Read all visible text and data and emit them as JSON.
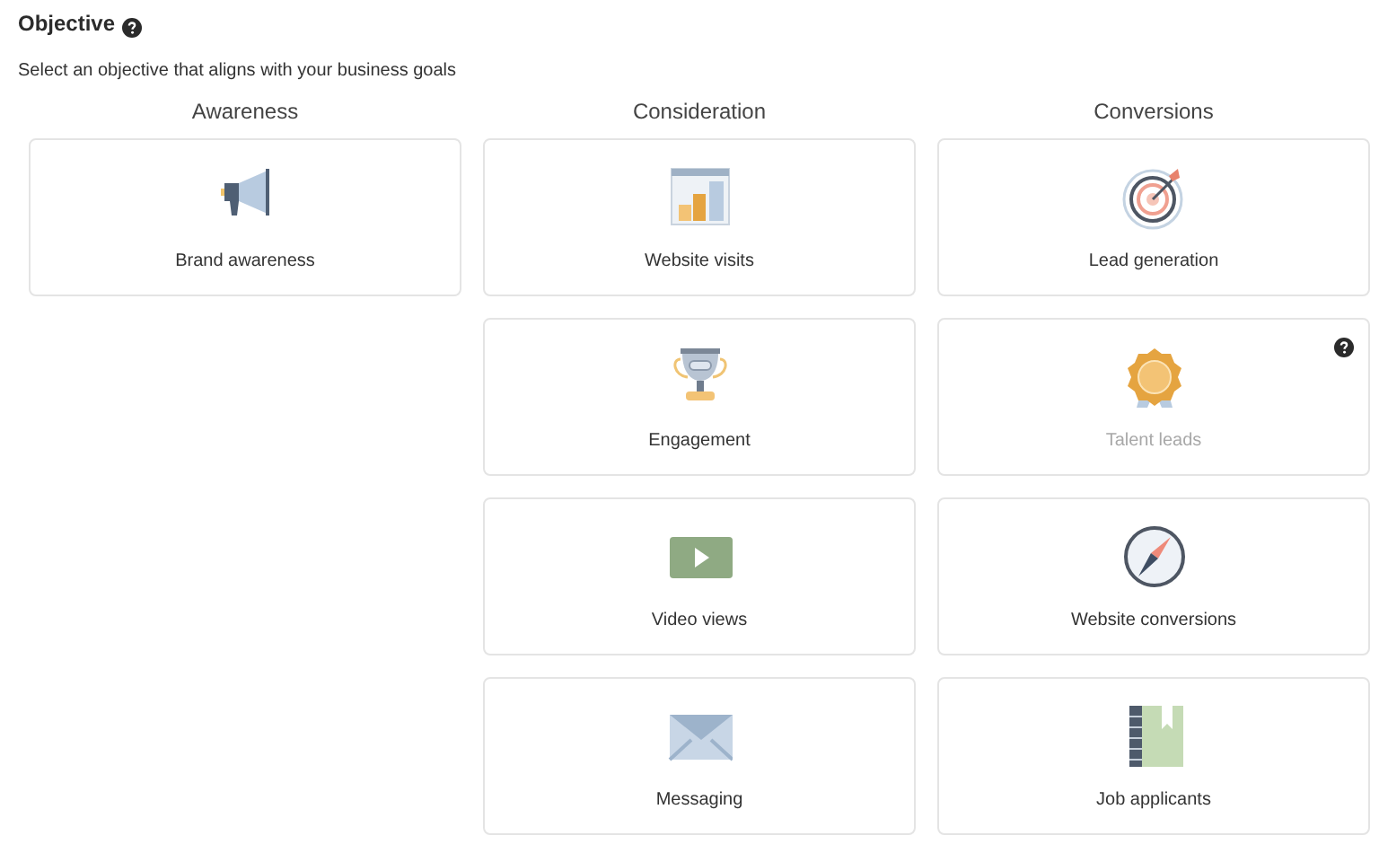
{
  "heading": {
    "title": "Objective",
    "help": true,
    "subtitle": "Select an objective that aligns with your business goals"
  },
  "columns": [
    {
      "title": "Awareness",
      "objectives": [
        {
          "label": "Brand awareness",
          "kind": "megaphone",
          "disabled": false,
          "help": false
        }
      ]
    },
    {
      "title": "Consideration",
      "objectives": [
        {
          "label": "Website visits",
          "kind": "chart",
          "disabled": false,
          "help": false
        },
        {
          "label": "Engagement",
          "kind": "trophy",
          "disabled": false,
          "help": false
        },
        {
          "label": "Video views",
          "kind": "video",
          "disabled": false,
          "help": false
        },
        {
          "label": "Messaging",
          "kind": "envelope",
          "disabled": false,
          "help": false
        }
      ]
    },
    {
      "title": "Conversions",
      "objectives": [
        {
          "label": "Lead generation",
          "kind": "target",
          "disabled": false,
          "help": false
        },
        {
          "label": "Talent leads",
          "kind": "medal",
          "disabled": true,
          "help": true
        },
        {
          "label": "Website conversions",
          "kind": "compass",
          "disabled": false,
          "help": false
        },
        {
          "label": "Job applicants",
          "kind": "notebook",
          "disabled": false,
          "help": false
        }
      ]
    }
  ]
}
